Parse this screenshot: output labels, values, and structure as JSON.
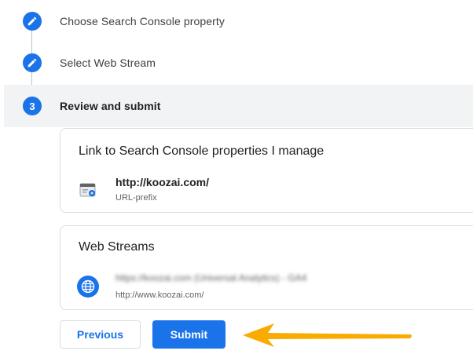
{
  "steps": [
    {
      "label": "Choose Search Console property",
      "state": "done"
    },
    {
      "label": "Select Web Stream",
      "state": "done"
    },
    {
      "number": "3",
      "label": "Review and submit",
      "state": "active"
    }
  ],
  "search_console_card": {
    "title": "Link to Search Console properties I manage",
    "property_url": "http://koozai.com/",
    "property_type": "URL-prefix",
    "icon": "search-console-icon"
  },
  "web_streams_card": {
    "title": "Web Streams",
    "stream_name": "https://koozai.com (Universal Analytics) - GA4",
    "stream_url": "http://www.koozai.com/",
    "icon": "globe-icon"
  },
  "buttons": {
    "previous": "Previous",
    "submit": "Submit"
  },
  "colors": {
    "accent": "#1a73e8",
    "active_step_bg": "#f1f3f4",
    "arrow": "#f9ab00"
  }
}
